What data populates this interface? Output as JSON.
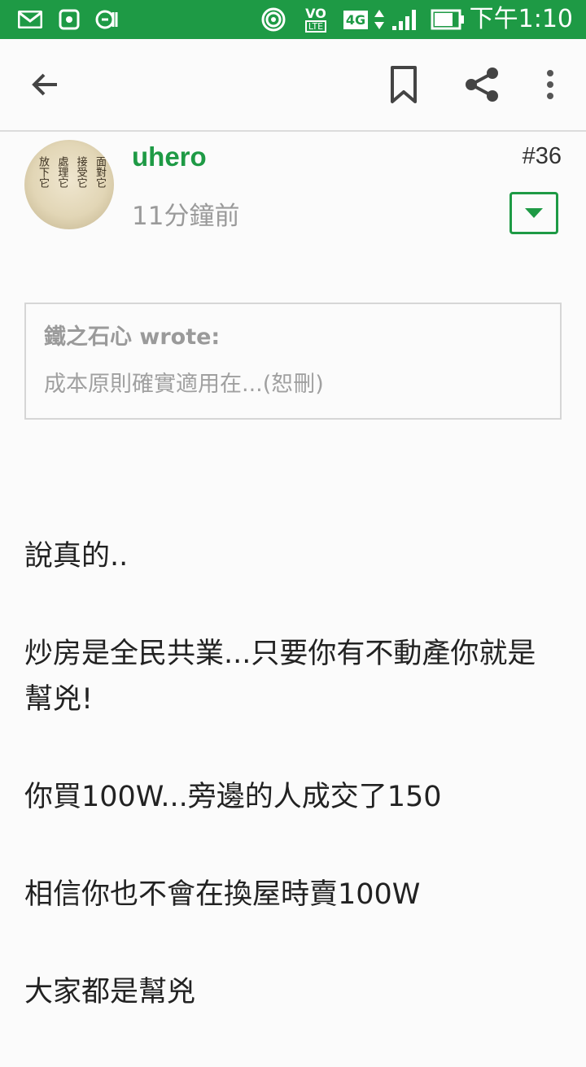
{
  "status_bar": {
    "time": "下午1:10",
    "network_label": "4G",
    "volte_label": "VO",
    "volte_sub": "LTE",
    "icons": [
      "gmail-icon",
      "app-icon",
      "nfc-icon",
      "hotspot-icon",
      "volte-icon",
      "4g-icon",
      "signal-icon",
      "battery-icon"
    ]
  },
  "app_bar": {
    "icons": [
      "back-arrow-icon",
      "bookmark-icon",
      "share-icon",
      "more-vert-icon"
    ]
  },
  "post": {
    "username": "uhero",
    "time_ago": "11分鐘前",
    "post_number": "#36",
    "avatar_text": [
      "面對它",
      "接受它",
      "處理它",
      "放下它"
    ],
    "quote": {
      "author": "鐵之石心 wrote:",
      "text": "成本原則確實適用在...(恕刪)"
    },
    "paragraphs": [
      "說真的..",
      "炒房是全民共業...只要你有不動產你就是幫兇!",
      "你買100W...旁邊的人成交了150",
      "相信你也不會在換屋時賣100W",
      "大家都是幫兇"
    ]
  },
  "colors": {
    "brand_green": "#1e9a45",
    "muted_text": "#9a9a9a"
  }
}
